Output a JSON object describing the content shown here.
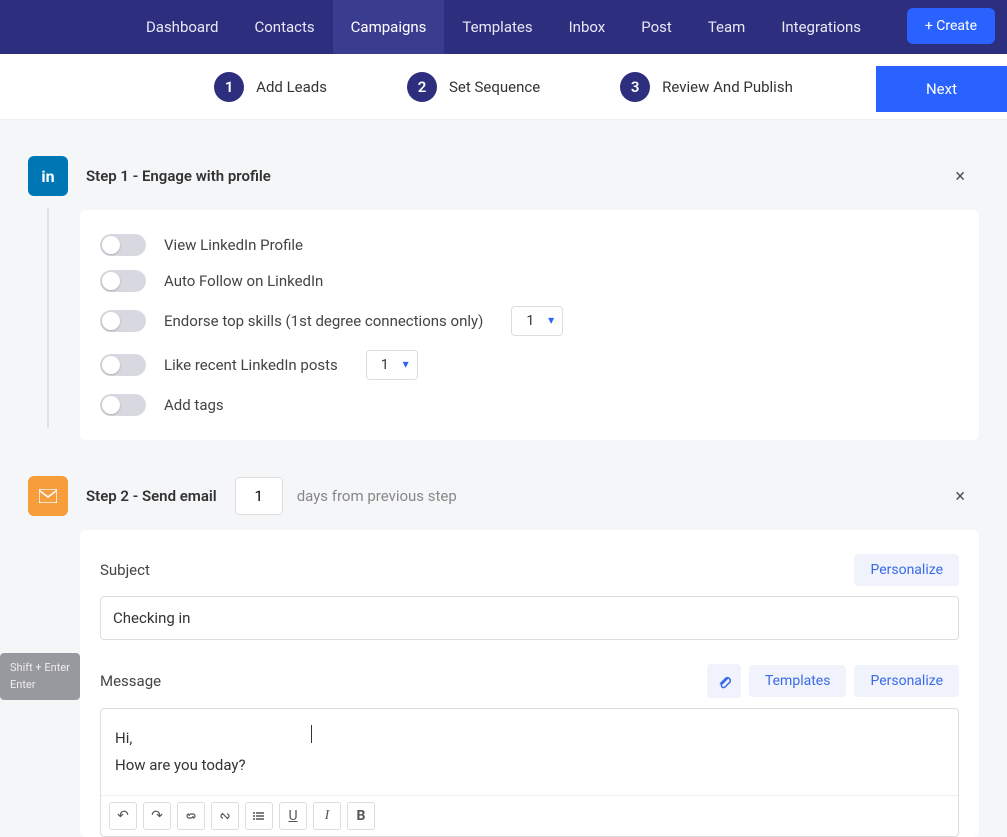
{
  "nav": {
    "items": [
      "Dashboard",
      "Contacts",
      "Campaigns",
      "Templates",
      "Inbox",
      "Post",
      "Team",
      "Integrations"
    ],
    "active_index": 2,
    "create_label": "+ Create"
  },
  "progress": {
    "steps": [
      {
        "num": "1",
        "label": "Add Leads"
      },
      {
        "num": "2",
        "label": "Set Sequence"
      },
      {
        "num": "3",
        "label": "Review And Publish"
      }
    ],
    "next_label": "Next"
  },
  "step1": {
    "icon_text": "in",
    "title": "Step 1 - Engage with profile",
    "toggles": [
      {
        "label": "View LinkedIn Profile"
      },
      {
        "label": "Auto Follow on LinkedIn"
      },
      {
        "label": "Endorse top skills (1st degree connections only)",
        "select": "1"
      },
      {
        "label": "Like recent LinkedIn posts",
        "select": "1"
      },
      {
        "label": "Add tags"
      }
    ]
  },
  "step2": {
    "title": "Step 2 - Send email",
    "days_value": "1",
    "days_suffix": "days from previous step",
    "subject_label": "Subject",
    "personalize_label": "Personalize",
    "subject_value": "Checking in",
    "message_label": "Message",
    "templates_label": "Templates",
    "message_line1": "Hi,",
    "message_line2": "How are you today?",
    "toolbar": {
      "undo": "↶",
      "redo": "↷",
      "link": "🔗",
      "unlink": "✂",
      "list": "≡",
      "u": "U",
      "i": "I",
      "b": "B"
    }
  },
  "hint": {
    "line1": "Shift + Enter",
    "line2": "Enter"
  }
}
